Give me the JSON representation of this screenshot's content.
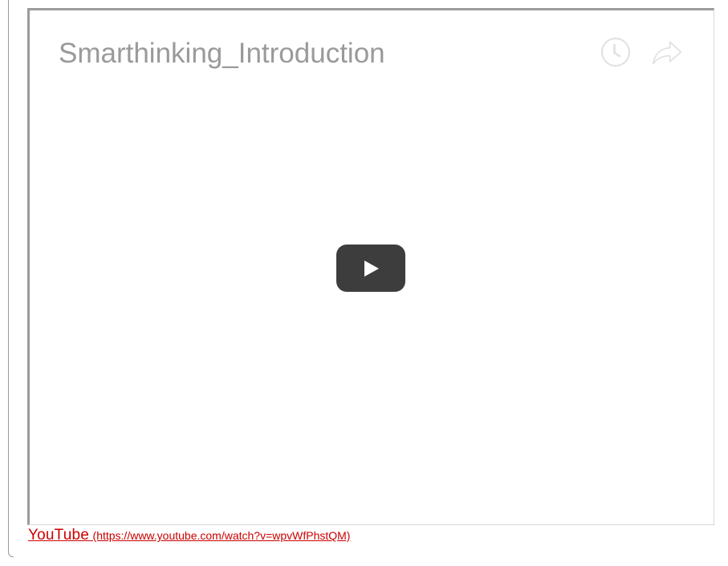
{
  "video": {
    "title": "Smarthinking_Introduction",
    "icons": {
      "watch_later": "clock-icon",
      "share": "share-arrow-icon",
      "play": "play-icon"
    }
  },
  "caption": {
    "source_label": "YouTube",
    "url_text": "(https://www.youtube.com/watch?v=wpvWfPhstQM)"
  },
  "colors": {
    "link": "#cc0000",
    "title_gray": "#9a9a9a",
    "play_button_bg": "#3d3d3d",
    "frame_border": "#9b9b9b"
  }
}
